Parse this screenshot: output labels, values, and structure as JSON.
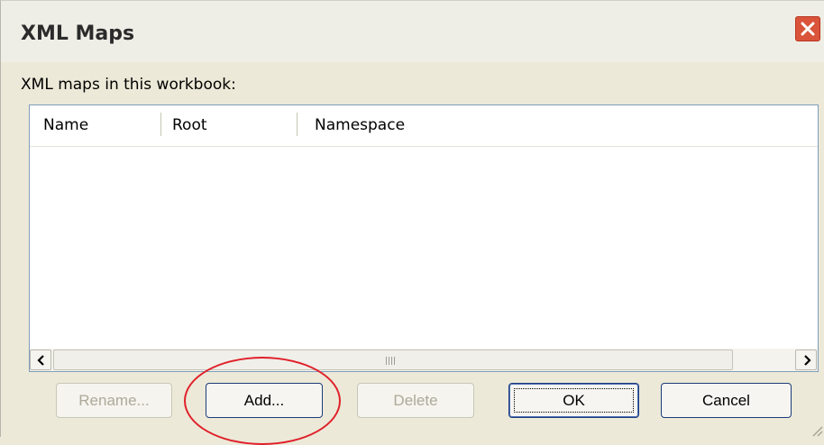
{
  "window": {
    "title": "XML Maps"
  },
  "list": {
    "caption": "XML maps in this workbook:",
    "columns": [
      "Name",
      "Root",
      "Namespace"
    ],
    "rows": []
  },
  "buttons": {
    "rename": "Rename...",
    "add": "Add...",
    "delete": "Delete",
    "ok": "OK",
    "cancel": "Cancel"
  },
  "icons": {
    "close": "close-icon",
    "scroll_left": "chevron-left-icon",
    "scroll_right": "chevron-right-icon",
    "thumb_grip": "grip-icon"
  },
  "colors": {
    "dialog_bg": "#ece9d8",
    "close_button": "#d9543a",
    "highlight_ring": "#e0202a",
    "disabled_text": "#acaa99"
  }
}
